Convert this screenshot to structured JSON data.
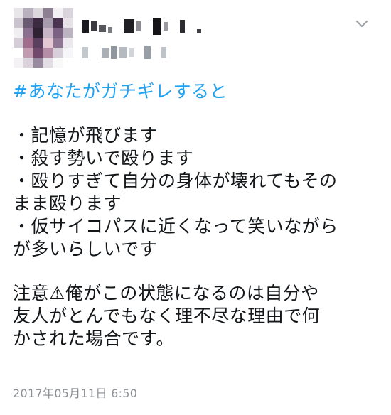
{
  "tweet": {
    "hashtag": "#あなたがガチギレすると",
    "lines": [
      "・記憶が飛びます",
      "・殺す勢いで殴ります",
      "・殴りすぎて自分の身体が壊れてもその",
      "まま殴ります",
      "・仮サイコパスに近くなって笑いながら",
      "が多いらしいです"
    ],
    "note_lines": [
      "注意⚠俺がこの状態になるのは自分や",
      "友人がとんでもなく理不尽な理由で何",
      "かされた場合です。"
    ],
    "timestamp": "2017年05月11日 6:50"
  },
  "colors": {
    "hashtag": "#1da1f2",
    "timestamp": "#8a8d91",
    "chevron": "#9ea3a8"
  },
  "icons": {
    "menu": "chevron-down-icon"
  }
}
